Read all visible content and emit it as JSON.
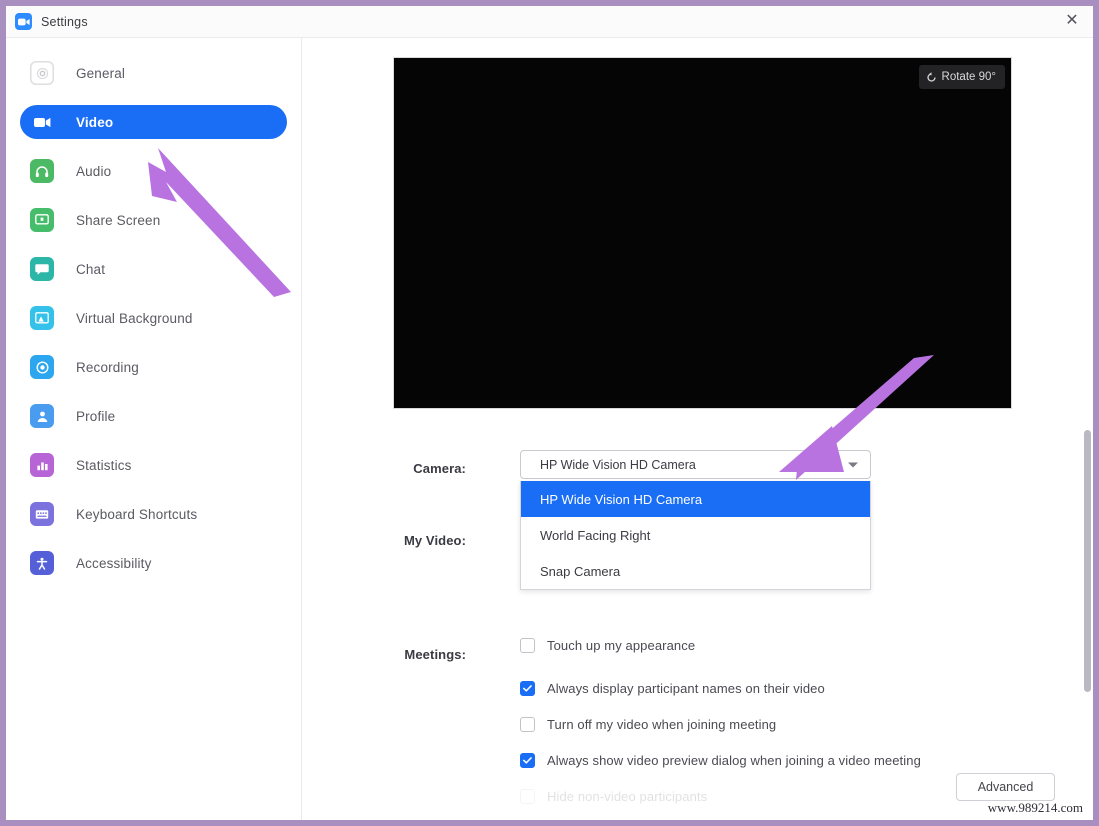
{
  "window": {
    "title": "Settings",
    "app_icon": "zoom-logo-icon",
    "close_label": "✕"
  },
  "sidebar": {
    "items": [
      {
        "label": "General",
        "icon": "gear-icon",
        "color": "#e3e3e8",
        "active": false
      },
      {
        "label": "Video",
        "icon": "video-camera-icon",
        "color": "#1a6ef5",
        "active": true
      },
      {
        "label": "Audio",
        "icon": "headphones-icon",
        "color": "#4cb964",
        "active": false
      },
      {
        "label": "Share Screen",
        "icon": "share-screen-icon",
        "color": "#45bd6a",
        "active": false
      },
      {
        "label": "Chat",
        "icon": "chat-bubble-icon",
        "color": "#2bb6a8",
        "active": false
      },
      {
        "label": "Virtual Background",
        "icon": "virtual-background-icon",
        "color": "#35c2ea",
        "active": false
      },
      {
        "label": "Recording",
        "icon": "record-circle-icon",
        "color": "#2ba6ef",
        "active": false
      },
      {
        "label": "Profile",
        "icon": "person-icon",
        "color": "#4a9cf0",
        "active": false
      },
      {
        "label": "Statistics",
        "icon": "bar-chart-icon",
        "color": "#b764d6",
        "active": false
      },
      {
        "label": "Keyboard Shortcuts",
        "icon": "keyboard-icon",
        "color": "#7b72de",
        "active": false
      },
      {
        "label": "Accessibility",
        "icon": "accessibility-icon",
        "color": "#5560d8",
        "active": false
      }
    ]
  },
  "main": {
    "video_preview": {
      "rotate_label": "Rotate 90°",
      "rotate_icon": "rotate-icon",
      "background_color": "#050505"
    },
    "camera": {
      "label": "Camera:",
      "selected": "HP Wide Vision HD Camera",
      "caret_icon": "chevron-down-icon",
      "options": [
        {
          "label": "HP Wide Vision HD Camera",
          "selected": true
        },
        {
          "label": "World Facing Right",
          "selected": false
        },
        {
          "label": "Snap Camera",
          "selected": false
        }
      ]
    },
    "my_video": {
      "label": "My Video:",
      "options": [
        {
          "label": "Touch up my appearance",
          "checked": false
        }
      ]
    },
    "meetings": {
      "label": "Meetings:",
      "options": [
        {
          "label": "Always display participant names on their video",
          "checked": true
        },
        {
          "label": "Turn off my video when joining meeting",
          "checked": false
        },
        {
          "label": "Always show video preview dialog when joining a video meeting",
          "checked": true
        },
        {
          "label": "Hide non-video participants",
          "checked": false
        }
      ]
    },
    "advanced_button": "Advanced"
  },
  "annotations": {
    "arrow_color": "#b873e0",
    "arrow_count": 2
  },
  "watermark": "www.989214.com",
  "colors": {
    "accent_blue": "#1a6ef5",
    "annotation_purple": "#b873e0",
    "frame_purple": "#a98fc0",
    "text_dark": "#3a3a42"
  }
}
